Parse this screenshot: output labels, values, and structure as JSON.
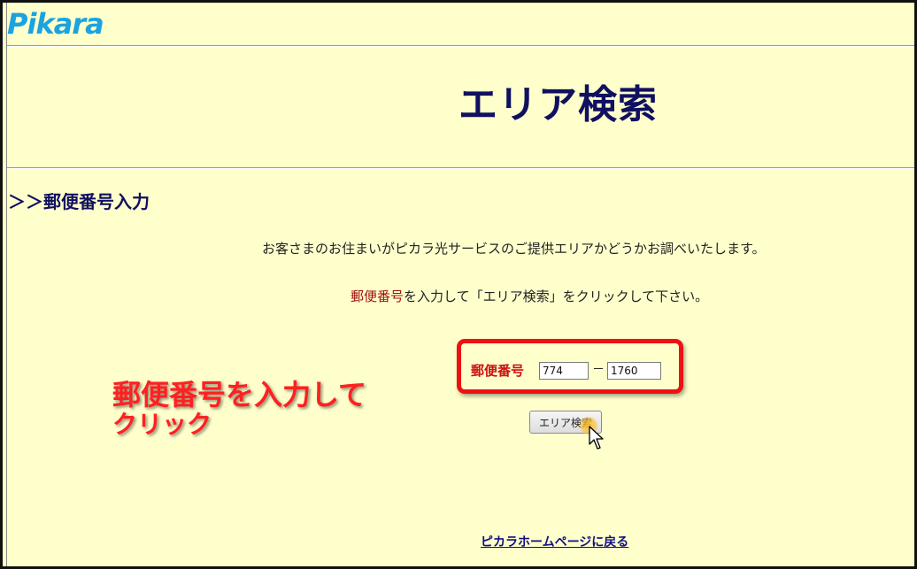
{
  "header": {
    "logo_text": "ikara",
    "logo_initial": "P"
  },
  "page": {
    "title": "エリア検索"
  },
  "section": {
    "title": "＞＞郵便番号入力"
  },
  "description": {
    "line1": "お客さまのお住まいがピカラ光サービスのご提供エリアかどうかお調べいたします。",
    "line2_red": "郵便番号",
    "line2_rest": "を入力して「エリア検索」をクリックして下さい。"
  },
  "form": {
    "postal_label": "郵便番号",
    "postal_first_value": "774",
    "postal_separator": "－",
    "postal_second_value": "1760",
    "search_button_label": "エリア検索"
  },
  "annotation": {
    "line1": "郵便番号を入力して",
    "line2": "クリック"
  },
  "footer": {
    "home_link": "ピカラホームページに戻る"
  },
  "colors": {
    "background": "#FFFFCC",
    "title": "#101060",
    "highlight_red": "#ee1111",
    "logo_blue": "#1aa3e0"
  }
}
